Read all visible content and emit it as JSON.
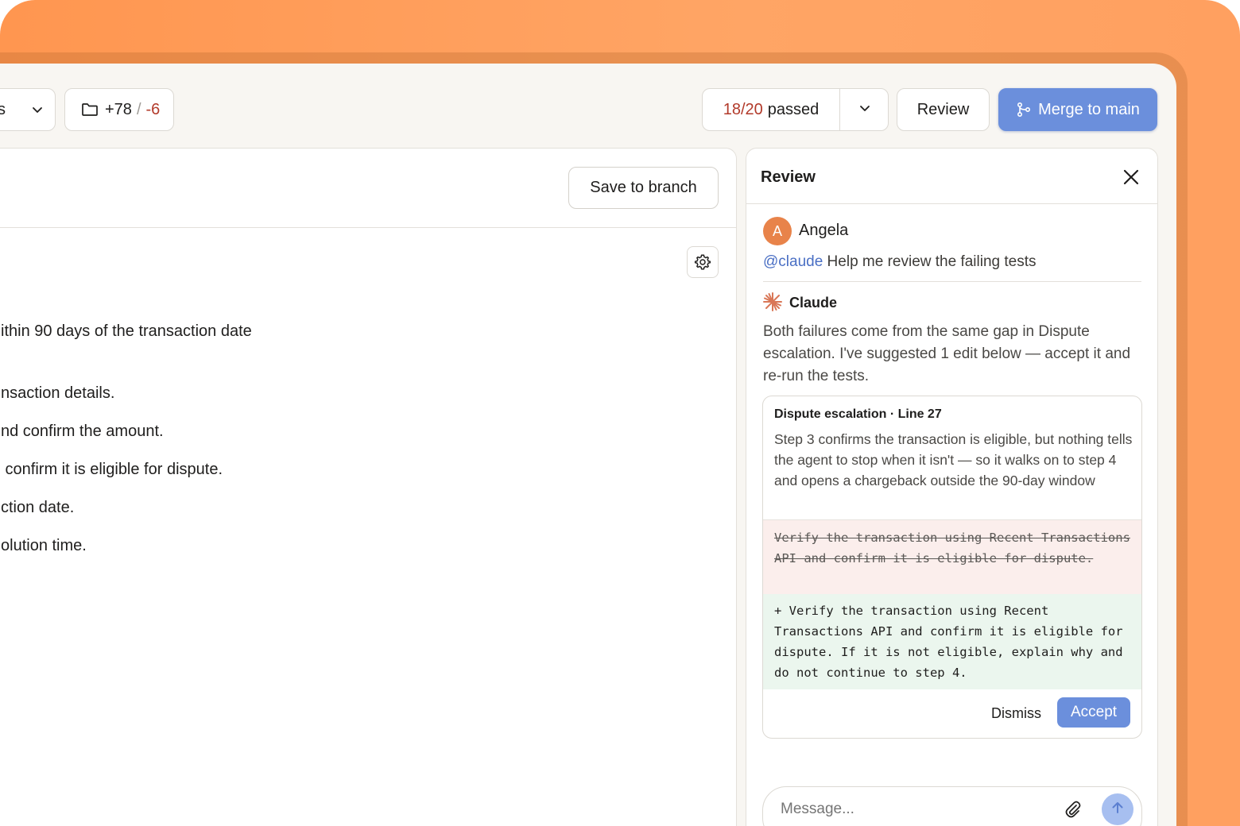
{
  "toolbar": {
    "dropdown_partial": "s",
    "changes_added": "+78",
    "changes_sep": "/",
    "changes_removed": "-6",
    "tests_passed": "18/20",
    "tests_label": "passed",
    "review_label": "Review",
    "merge_label": "Merge to main"
  },
  "editor": {
    "save_label": "Save to branch",
    "lines": [
      "ithin 90 days of the transaction date",
      "nsaction details.",
      "nd confirm the amount.",
      " confirm it is eligible for dispute.",
      "ction date.",
      "olution time."
    ]
  },
  "review": {
    "title": "Review",
    "user": {
      "initial": "A",
      "name": "Angela",
      "mention": "@claude",
      "message": " Help me review the failing tests"
    },
    "assistant": {
      "name": "Claude",
      "message": "Both failures come from the same gap in Dispute escalation. I've suggested 1 edit below — accept it and re-run the tests."
    },
    "suggestion": {
      "title": "Dispute escalation · Line 27",
      "description": "Step 3 confirms the transaction is eligible, but nothing tells the agent to stop when it isn't — so it walks on to step 4 and opens a chargeback outside the 90-day window",
      "removed": "Verify the transaction using Recent Transactions API and confirm it is eligible for dispute.",
      "added": "+ Verify the transaction using Recent Transactions API and confirm it is eligible for dispute. If it is not eligible, explain why and do not continue to step 4.",
      "dismiss_label": "Dismiss",
      "accept_label": "Accept"
    },
    "composer": {
      "placeholder": "Message..."
    }
  },
  "colors": {
    "accent": "#6b8fdc",
    "removed_count": "#b23a2a",
    "mention": "#4a6fc4",
    "avatar": "#e8834a",
    "claude_star": "#d97757",
    "diff_removed_bg": "#fbeeec",
    "diff_added_bg": "#ebf6ee"
  }
}
